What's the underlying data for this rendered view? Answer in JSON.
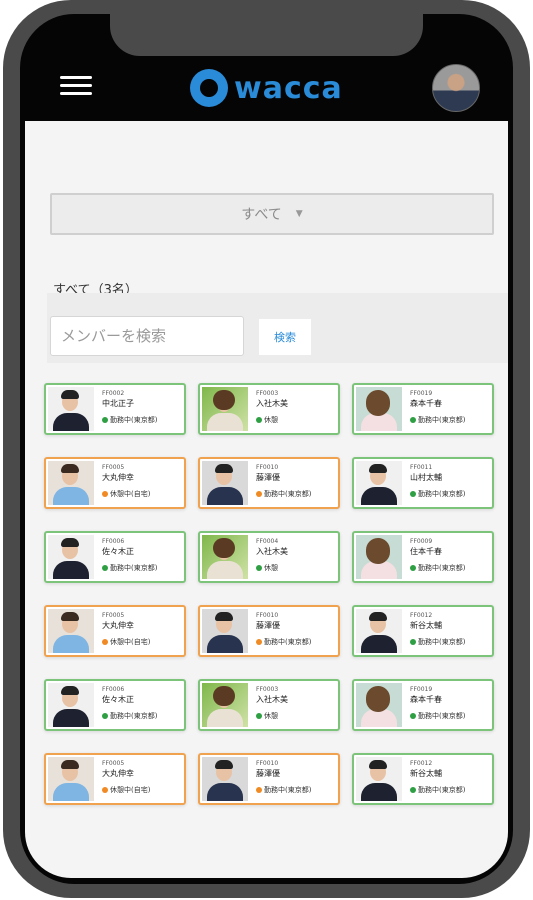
{
  "app": {
    "logo_text": "wacca",
    "accent": "#2a8bd8"
  },
  "filter": {
    "selected": "すべて"
  },
  "list": {
    "count_label": "すべて（3名）"
  },
  "search": {
    "placeholder": "メンバーを検索",
    "button_label": "検索"
  },
  "status_colors": {
    "green": "#2ea043",
    "orange": "#f08a24",
    "gray": "#2ea043"
  },
  "members": [
    {
      "code": "FF0002",
      "name": "中北正子",
      "status": "勤務中(東京都)",
      "dot": "green",
      "photo": "suit",
      "border": "green"
    },
    {
      "code": "FF0003",
      "name": "入社木美",
      "status": "休憩",
      "dot": "green",
      "photo": "woman",
      "border": "green"
    },
    {
      "code": "FF0019",
      "name": "森本千春",
      "status": "勤務中(東京都)",
      "dot": "green",
      "photo": "lady",
      "border": "green"
    },
    {
      "code": "FF0005",
      "name": "大丸伸幸",
      "status": "休憩中(自宅)",
      "dot": "orange",
      "photo": "casual",
      "border": "orange"
    },
    {
      "code": "FF0010",
      "name": "藤澤優",
      "status": "勤務中(東京都)",
      "dot": "orange",
      "photo": "glasses",
      "border": "orange"
    },
    {
      "code": "FF0011",
      "name": "山村太輔",
      "status": "勤務中(東京都)",
      "dot": "green",
      "photo": "suit",
      "border": "green"
    },
    {
      "code": "FF0006",
      "name": "佐々木正",
      "status": "勤務中(東京都)",
      "dot": "green",
      "photo": "suit",
      "border": "green"
    },
    {
      "code": "FF0004",
      "name": "入社木美",
      "status": "休憩",
      "dot": "green",
      "photo": "woman",
      "border": "green"
    },
    {
      "code": "FF0009",
      "name": "住本千春",
      "status": "勤務中(東京都)",
      "dot": "green",
      "photo": "lady",
      "border": "green"
    },
    {
      "code": "FF0005",
      "name": "大丸伸幸",
      "status": "休憩中(自宅)",
      "dot": "orange",
      "photo": "casual",
      "border": "orange"
    },
    {
      "code": "FF0010",
      "name": "藤澤優",
      "status": "勤務中(東京都)",
      "dot": "orange",
      "photo": "glasses",
      "border": "orange"
    },
    {
      "code": "FF0012",
      "name": "新谷太輔",
      "status": "勤務中(東京都)",
      "dot": "green",
      "photo": "suit",
      "border": "green"
    },
    {
      "code": "FF0006",
      "name": "佐々木正",
      "status": "勤務中(東京都)",
      "dot": "green",
      "photo": "suit",
      "border": "green"
    },
    {
      "code": "FF0003",
      "name": "入社木美",
      "status": "休憩",
      "dot": "green",
      "photo": "woman",
      "border": "green"
    },
    {
      "code": "FF0019",
      "name": "森本千春",
      "status": "勤務中(東京都)",
      "dot": "green",
      "photo": "lady",
      "border": "green"
    },
    {
      "code": "FF0005",
      "name": "大丸伸幸",
      "status": "休憩中(自宅)",
      "dot": "orange",
      "photo": "casual",
      "border": "orange"
    },
    {
      "code": "FF0010",
      "name": "藤澤優",
      "status": "勤務中(東京都)",
      "dot": "orange",
      "photo": "glasses",
      "border": "orange"
    },
    {
      "code": "FF0012",
      "name": "新谷太輔",
      "status": "勤務中(東京都)",
      "dot": "green",
      "photo": "suit",
      "border": "green"
    }
  ]
}
